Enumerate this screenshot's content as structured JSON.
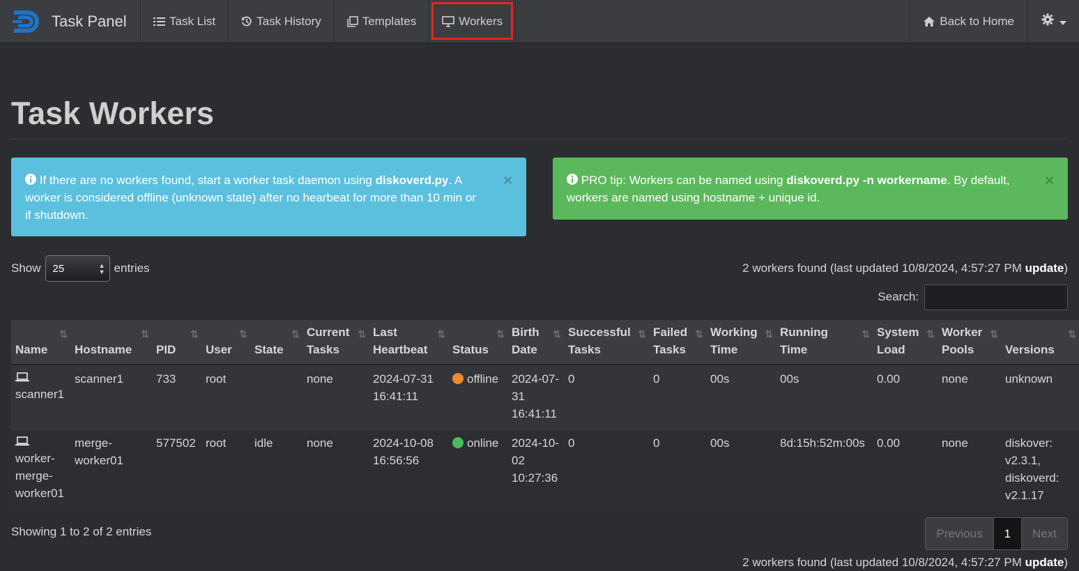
{
  "nav": {
    "brand": "Task Panel",
    "items": [
      {
        "label": "Task List",
        "icon": "list-icon"
      },
      {
        "label": "Task History",
        "icon": "history-icon"
      },
      {
        "label": "Templates",
        "icon": "copy-icon"
      },
      {
        "label": "Workers",
        "icon": "monitor-icon",
        "active": true
      }
    ],
    "back_home": "Back to Home",
    "settings_icon": "gear-icon"
  },
  "page": {
    "title": "Task Workers"
  },
  "alerts": {
    "info": {
      "pre": " If there are no workers found, start a worker task daemon using ",
      "bold": "diskoverd.py",
      "post": ". A worker is considered offline (unknown state) after no hearbeat for more than 10 min or if shutdown.",
      "close": "×"
    },
    "success": {
      "pre": " PRO tip: Workers can be named using ",
      "bold": "diskoverd.py -n workername",
      "post": ". By default, workers are named using hostname + unique id.",
      "close": "×"
    }
  },
  "table_controls": {
    "show_label": "Show",
    "entries_value": "25",
    "entries_label": "entries",
    "found_text": "2 workers found (last updated 10/8/2024, 4:57:27 PM ",
    "update_link": "update",
    "found_close": ")",
    "search_label": "Search:"
  },
  "table": {
    "headers": [
      [
        "",
        "Name"
      ],
      [
        "",
        "Hostname"
      ],
      [
        "",
        "PID"
      ],
      [
        "",
        "User"
      ],
      [
        "",
        "State"
      ],
      [
        "Current",
        "Tasks"
      ],
      [
        "Last",
        "Heartbeat"
      ],
      [
        "",
        "Status"
      ],
      [
        "Birth",
        "Date"
      ],
      [
        "Successful",
        "Tasks"
      ],
      [
        "Failed",
        "Tasks"
      ],
      [
        "Working",
        "Time"
      ],
      [
        "Running",
        "Time"
      ],
      [
        "System",
        "Load"
      ],
      [
        "Worker",
        "Pools"
      ],
      [
        "",
        "Versions"
      ]
    ],
    "rows": [
      {
        "name": "scanner1",
        "hostname": "scanner1",
        "pid": "733",
        "user": "root",
        "state": "",
        "current_tasks": "none",
        "last_heartbeat": "2024-07-31 16:41:11",
        "status": "offline",
        "status_color": "#f0892b",
        "birth_date": "2024-07-31 16:41:11",
        "successful": "0",
        "failed": "0",
        "working_time": "00s",
        "running_time": "00s",
        "system_load": "0.00",
        "worker_pools": "none",
        "versions": "unknown"
      },
      {
        "name": "worker-merge-worker01",
        "hostname": "merge-worker01",
        "pid": "577502",
        "user": "root",
        "state": "idle",
        "current_tasks": "none",
        "last_heartbeat": "2024-10-08 16:56:56",
        "status": "online",
        "status_color": "#4cbb5a",
        "birth_date": "2024-10-02 10:27:36",
        "successful": "0",
        "failed": "0",
        "working_time": "00s",
        "running_time": "8d:15h:52m:00s",
        "system_load": "0.00",
        "worker_pools": "none",
        "versions": "diskover: v2.3.1, diskoverd: v2.1.17"
      }
    ]
  },
  "footer": {
    "showing": "Showing 1 to 2 of 2 entries",
    "prev": "Previous",
    "page": "1",
    "next": "Next"
  }
}
